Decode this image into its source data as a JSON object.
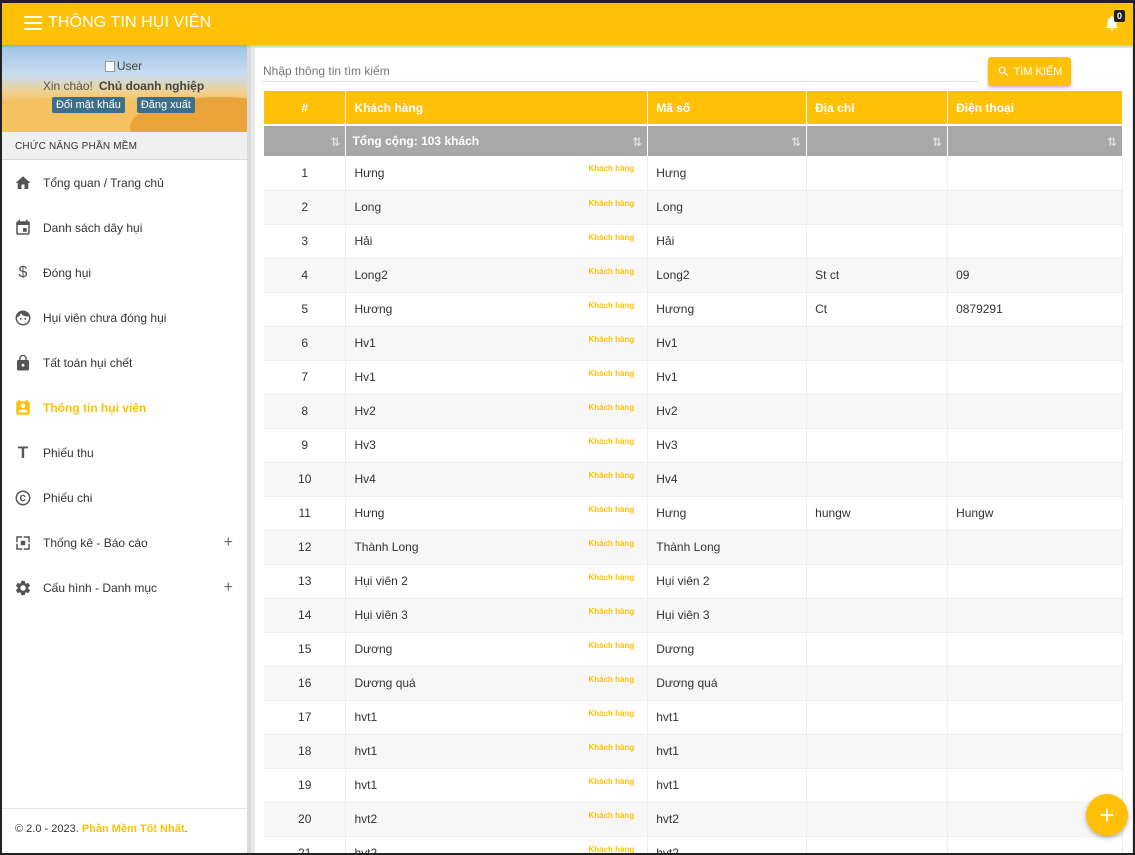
{
  "header": {
    "title": "THÔNG TIN HỤI VIÊN",
    "notification_count": "0"
  },
  "user": {
    "avatar_alt": "User",
    "greeting": "Xin chào!",
    "name": "Chủ doanh nghiệp",
    "change_password": "Đổi mật khẩu",
    "logout": "Đăng xuất"
  },
  "sidebar": {
    "section_title": "CHỨC NĂNG PHẦN MỀM",
    "items": [
      {
        "label": "Tổng quan / Trang chủ",
        "icon": "home-icon"
      },
      {
        "label": "Danh sách dây hụi",
        "icon": "calendar-icon"
      },
      {
        "label": "Đóng hụi",
        "icon": "dollar-icon"
      },
      {
        "label": "Hụi viên chưa đóng hụi",
        "icon": "face-icon"
      },
      {
        "label": "Tất toán hụi chết",
        "icon": "lock-icon"
      },
      {
        "label": "Thông tin hụi viên",
        "icon": "contact-icon",
        "active": true
      },
      {
        "label": "Phiếu thu",
        "icon": "text-t-icon"
      },
      {
        "label": "Phiếu chi",
        "icon": "copyright-icon"
      },
      {
        "label": "Thống kê - Báo cáo",
        "icon": "expand-icon",
        "expandable": true
      },
      {
        "label": "Cấu hình - Danh mục",
        "icon": "gear-icon",
        "expandable": true
      }
    ],
    "expand_symbol": "+",
    "footer_prefix": "© 2.0 - 2023.",
    "footer_brand": "Phần Mềm Tốt Nhất",
    "footer_suffix": "."
  },
  "search": {
    "placeholder": "Nhập thông tin tìm kiếm",
    "button_label": "TÌM KIẾM"
  },
  "table": {
    "headers": [
      "#",
      "Khách hàng",
      "Mã số",
      "Địa chỉ",
      "Điện thoại"
    ],
    "summary": "Tổng cộng: 103 khách",
    "tag_label": "Khách hàng",
    "rows": [
      [
        "1",
        "Hưng",
        "Hưng",
        "",
        ""
      ],
      [
        "2",
        "Long",
        "Long",
        "",
        ""
      ],
      [
        "3",
        "Hải",
        "Hải",
        "",
        ""
      ],
      [
        "4",
        "Long2",
        "Long2",
        "St ct",
        "09"
      ],
      [
        "5",
        "Hương",
        "Hương",
        "Ct",
        "0879291"
      ],
      [
        "6",
        "Hv1",
        "Hv1",
        "",
        ""
      ],
      [
        "7",
        "Hv1",
        "Hv1",
        "",
        ""
      ],
      [
        "8",
        "Hv2",
        "Hv2",
        "",
        ""
      ],
      [
        "9",
        "Hv3",
        "Hv3",
        "",
        ""
      ],
      [
        "10",
        "Hv4",
        "Hv4",
        "",
        ""
      ],
      [
        "11",
        "Hưng",
        "Hưng",
        "hungw",
        "Hungw"
      ],
      [
        "12",
        "Thành Long",
        "Thành Long",
        "",
        ""
      ],
      [
        "13",
        "Hụi viên 2",
        "Hụi viên 2",
        "",
        ""
      ],
      [
        "14",
        "Hụi viên 3",
        "Hụi viên 3",
        "",
        ""
      ],
      [
        "15",
        "Dương",
        "Dương",
        "",
        ""
      ],
      [
        "16",
        "Dương quá",
        "Dương quá",
        "",
        ""
      ],
      [
        "17",
        "hvt1",
        "hvt1",
        "",
        ""
      ],
      [
        "18",
        "hvt1",
        "hvt1",
        "",
        ""
      ],
      [
        "19",
        "hvt1",
        "hvt1",
        "",
        ""
      ],
      [
        "20",
        "hvt2",
        "hvt2",
        "",
        ""
      ],
      [
        "21",
        "hvt2",
        "hvt2",
        "",
        ""
      ]
    ]
  },
  "fab": {
    "label": "+"
  },
  "colors": {
    "accent": "#ffc107",
    "summary_bg": "#a8a8a8",
    "user_button": "#3d6f88"
  }
}
